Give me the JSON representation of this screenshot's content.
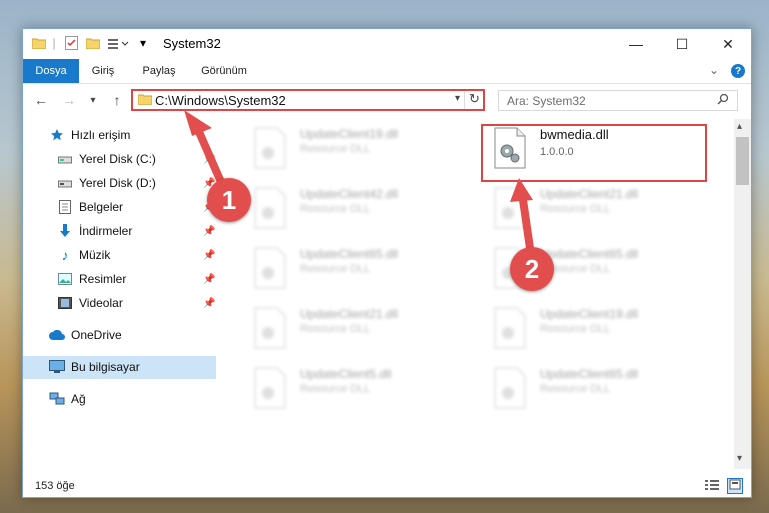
{
  "window": {
    "title": "System32",
    "controls": {
      "minimize": "—",
      "maximize": "☐",
      "close": "✕"
    }
  },
  "ribbon": {
    "tabs": [
      {
        "label": "Dosya",
        "active": true
      },
      {
        "label": "Giriş"
      },
      {
        "label": "Paylaş"
      },
      {
        "label": "Görünüm"
      }
    ]
  },
  "address_bar": {
    "path": "C:\\Windows\\System32"
  },
  "search": {
    "placeholder": "Ara: System32"
  },
  "sidebar": {
    "quick_access_label": "Hızlı erişim",
    "items": [
      {
        "label": "Yerel Disk (C:)",
        "icon": "drive-icon"
      },
      {
        "label": "Yerel Disk (D:)",
        "icon": "drive-icon"
      },
      {
        "label": "Belgeler",
        "icon": "documents-icon"
      },
      {
        "label": "İndirmeler",
        "icon": "download-icon"
      },
      {
        "label": "Müzik",
        "icon": "music-icon"
      },
      {
        "label": "Resimler",
        "icon": "pictures-icon"
      },
      {
        "label": "Videolar",
        "icon": "videos-icon"
      }
    ],
    "onedrive": "OneDrive",
    "this_pc": "Bu bilgisayar",
    "network": "Ağ"
  },
  "files": {
    "left_column": [
      {
        "name": "UpdateClient19.dll",
        "type": "Resource DLL"
      },
      {
        "name": "UpdateClient42.dll",
        "type": "Resource DLL"
      },
      {
        "name": "UpdateClient65.dll",
        "type": "Resource DLL"
      },
      {
        "name": "UpdateClient21.dll",
        "type": "Resource DLL"
      },
      {
        "name": "UpdateClient5.dll",
        "type": "Resource DLL"
      }
    ],
    "highlighted": {
      "name": "bwmedia.dll",
      "version": "1.0.0.0"
    },
    "right_column": [
      {
        "name": "UpdateClient21.dll",
        "type": "Resource DLL"
      },
      {
        "name": "UpdateClient65.dll",
        "type": "Resource DLL"
      },
      {
        "name": "UpdateClient19.dll",
        "type": "Resource DLL"
      },
      {
        "name": "UpdateClient65.dll",
        "type": "Resource DLL"
      }
    ]
  },
  "status": {
    "item_count": "153 öğe"
  },
  "annotations": {
    "badge1": "1",
    "badge2": "2"
  },
  "colors": {
    "accent": "#1979ca",
    "highlight": "#e14444"
  }
}
